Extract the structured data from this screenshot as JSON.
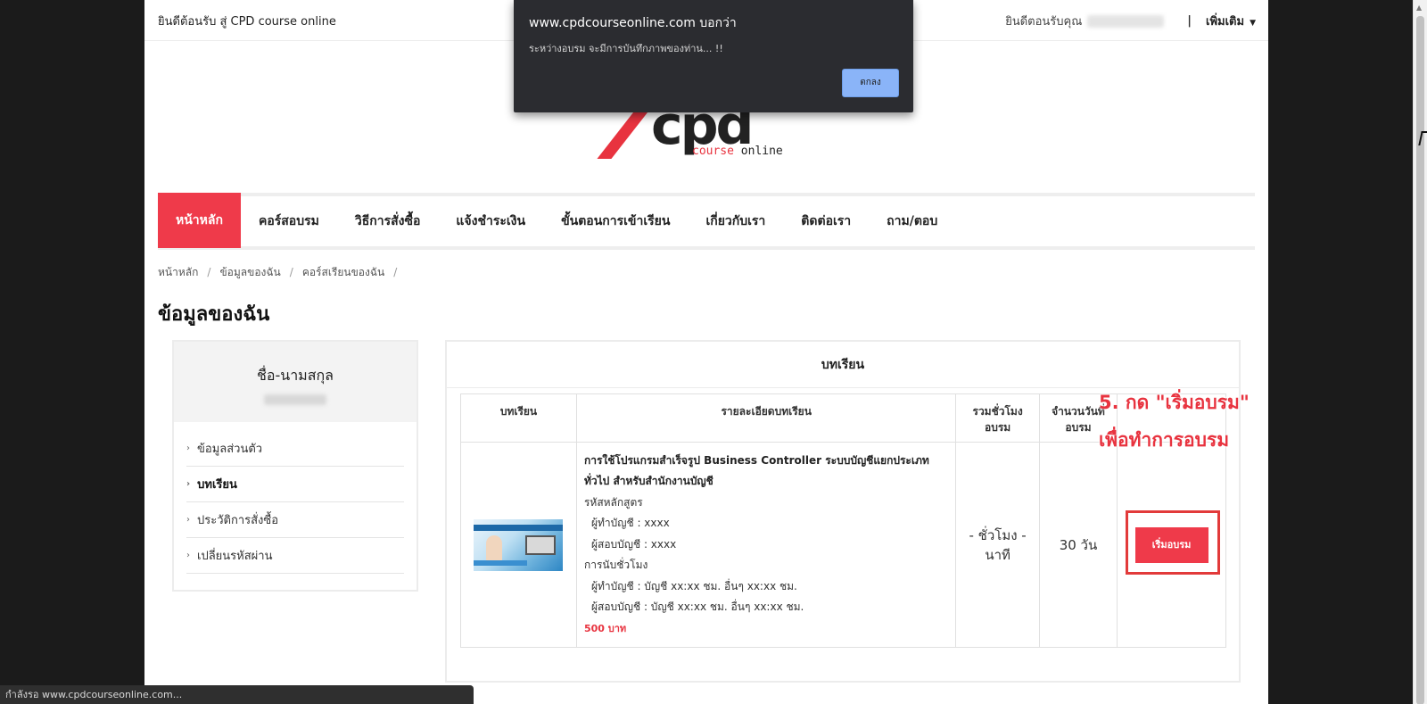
{
  "topbar": {
    "welcome": "ยินดีต้อนรับ สู่ CPD course online",
    "user_greeting": "ยินดีตอนรับคุณ",
    "separator": "|",
    "more_label": "เพิ่มเติม",
    "more_icon": "caret-down-icon"
  },
  "logo": {
    "letters": "cpd",
    "tagline_course": "course",
    "tagline_online": " online",
    "accent_color": "#e8333f"
  },
  "nav": {
    "items": [
      {
        "label": "หน้าหลัก",
        "active": true
      },
      {
        "label": "คอร์สอบรม"
      },
      {
        "label": "วิธีการสั่งซื้อ"
      },
      {
        "label": "แจ้งชำระเงิน"
      },
      {
        "label": "ขั้นตอนการเข้าเรียน"
      },
      {
        "label": "เกี่ยวกับเรา"
      },
      {
        "label": "ติดต่อเรา"
      },
      {
        "label": "ถาม/ตอบ"
      }
    ]
  },
  "breadcrumb": {
    "items": [
      "หน้าหลัก",
      "ข้อมูลของฉัน",
      "คอร์สเรียนของฉัน"
    ],
    "sep": "/"
  },
  "page_title": "ข้อมูลของฉัน",
  "profile": {
    "name_label": "ชื่อ-นามสกุล",
    "menu": [
      {
        "label": "ข้อมูลส่วนตัว"
      },
      {
        "label": "บทเรียน",
        "active": true
      },
      {
        "label": "ประวัติการสั่งซื้อ"
      },
      {
        "label": "เปลี่ยนรหัสผ่าน"
      }
    ],
    "chevron_icon": "chevron-right-icon"
  },
  "lessons": {
    "title": "บทเรียน",
    "headers": {
      "lesson": "บทเรียน",
      "detail": "รายละเอียดบทเรียน",
      "hours_1": "รวมชั่วโมง",
      "hours_2": "อบรม",
      "days_1": "จำนวนวันที่",
      "days_2": "อบรม"
    },
    "row": {
      "thumbnail_icon": "course-thumbnail-image",
      "course_title": "การใช้โปรแกรมสำเร็จรูป Business Controller ระบบบัญชีแยกประเภททั่วไป สำหรับสำนักงานบัญชี",
      "code_label": "รหัสหลักสูตร",
      "accountant_code": "ผู้ทำบัญชี : xxxx",
      "auditor_code": "ผู้สอบบัญชี : xxxx",
      "hour_count_label": "การนับชั่วโมง",
      "accountant_hours": "ผู้ทำบัญชี : บัญชี xx:xx ชม. อื่นๆ xx:xx ชม.",
      "auditor_hours": "ผู้สอบบัญชี : บัญชี xx:xx ชม. อื่นๆ xx:xx ชม.",
      "price": "500 บาท",
      "hours_value_1": "- ชั่วโมง -",
      "hours_value_2": "นาที",
      "days_value": "30 วัน",
      "start_button": "เริ่มอบรม"
    }
  },
  "annotation": {
    "line1": "5. กด \"เริ่มอบรม\"",
    "line2": "เพื่อทำการอบรม"
  },
  "dialog": {
    "title": "www.cpdcourseonline.com บอกว่า",
    "message": "ระหว่างอบรม จะมีการบันทึกภาพของท่าน... !!",
    "ok_label": "ตกลง"
  },
  "statusbar": {
    "text": "กำลังรอ www.cpdcourseonline.com..."
  }
}
